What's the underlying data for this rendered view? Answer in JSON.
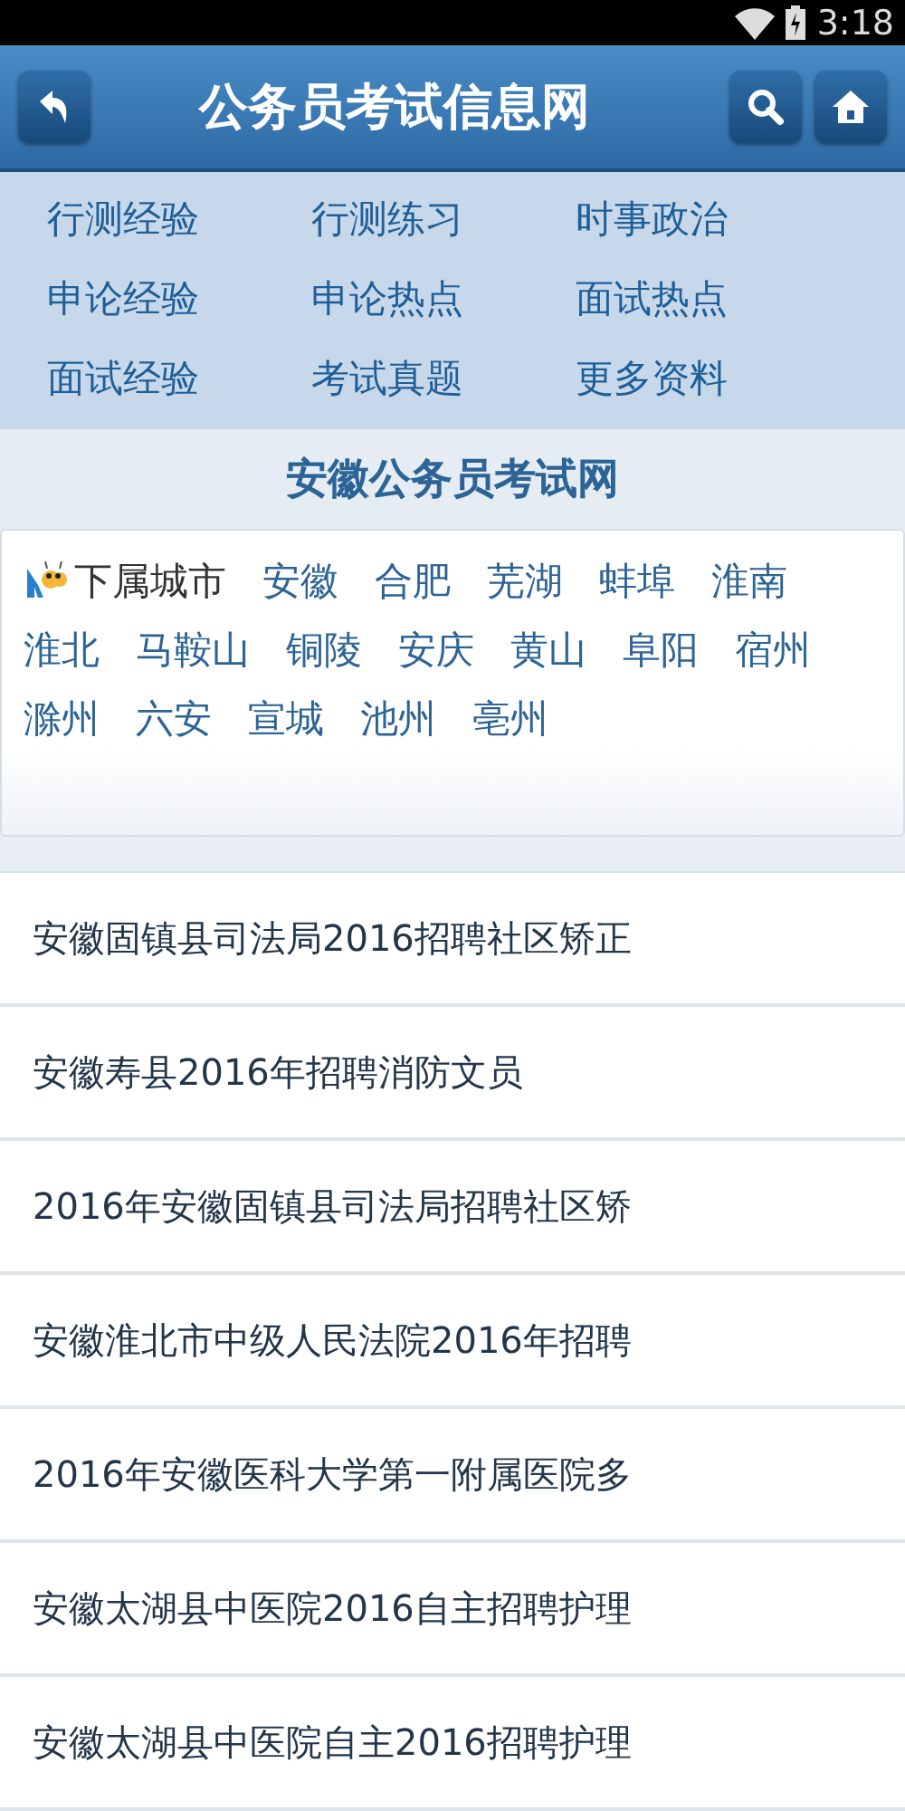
{
  "status_bar": {
    "time": "3:18"
  },
  "header": {
    "title": "公务员考试信息网"
  },
  "nav_links": [
    "行测经验",
    "行测练习",
    "时事政治",
    "申论经验",
    "申论热点",
    "面试热点",
    "面试经验",
    "考试真题",
    "更多资料"
  ],
  "section_title": "安徽公务员考试网",
  "cities": {
    "label": "下属城市",
    "items": [
      "安徽",
      "合肥",
      "芜湖",
      "蚌埠",
      "淮南",
      "淮北",
      "马鞍山",
      "铜陵",
      "安庆",
      "黄山",
      "阜阳",
      "宿州",
      "滁州",
      "六安",
      "宣城",
      "池州",
      "亳州"
    ]
  },
  "articles": [
    "安徽固镇县司法局2016招聘社区矫正",
    "安徽寿县2016年招聘消防文员",
    "2016年安徽固镇县司法局招聘社区矫",
    "安徽淮北市中级人民法院2016年招聘",
    "2016年安徽医科大学第一附属医院多",
    "安徽太湖县中医院2016自主招聘护理",
    "安徽太湖县中医院自主2016招聘护理"
  ]
}
